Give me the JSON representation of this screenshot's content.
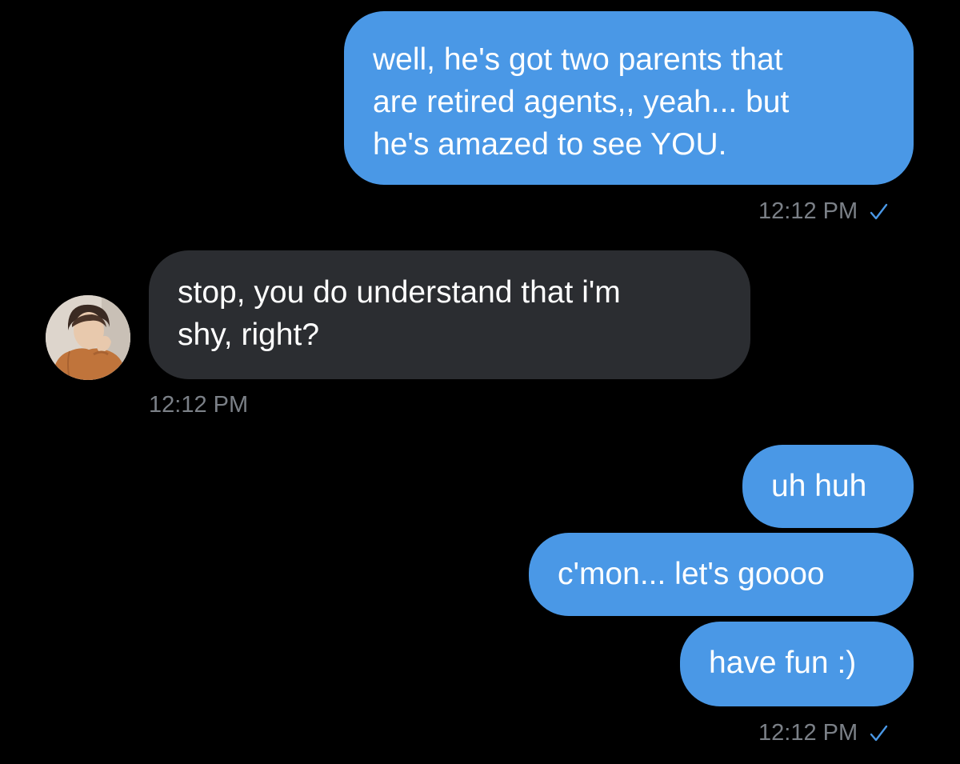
{
  "conversation": {
    "messages": [
      {
        "direction": "outgoing",
        "lines": [
          "well, he's got two parents that",
          "are retired agents,, yeah... but",
          "he's amazed to see YOU."
        ]
      },
      {
        "direction": "incoming",
        "lines": [
          "stop, you do understand that i'm",
          "shy, right?"
        ]
      },
      {
        "direction": "outgoing",
        "text": "uh huh"
      },
      {
        "direction": "outgoing",
        "text": "c'mon... let's goooo"
      },
      {
        "direction": "outgoing",
        "text": "have fun :)"
      }
    ],
    "timestamps": {
      "first_outgoing": "12:12 PM",
      "incoming": "12:12 PM",
      "last_outgoing": "12:12 PM"
    },
    "read_receipt_icon": "checkmark-icon",
    "contact_avatar_icon": "contact-avatar"
  },
  "colors": {
    "background": "#000000",
    "outgoing_bubble": "#4a98e6",
    "incoming_bubble": "#2b2d31",
    "timestamp_text": "#7b8087",
    "checkmark": "#4a98e6"
  }
}
